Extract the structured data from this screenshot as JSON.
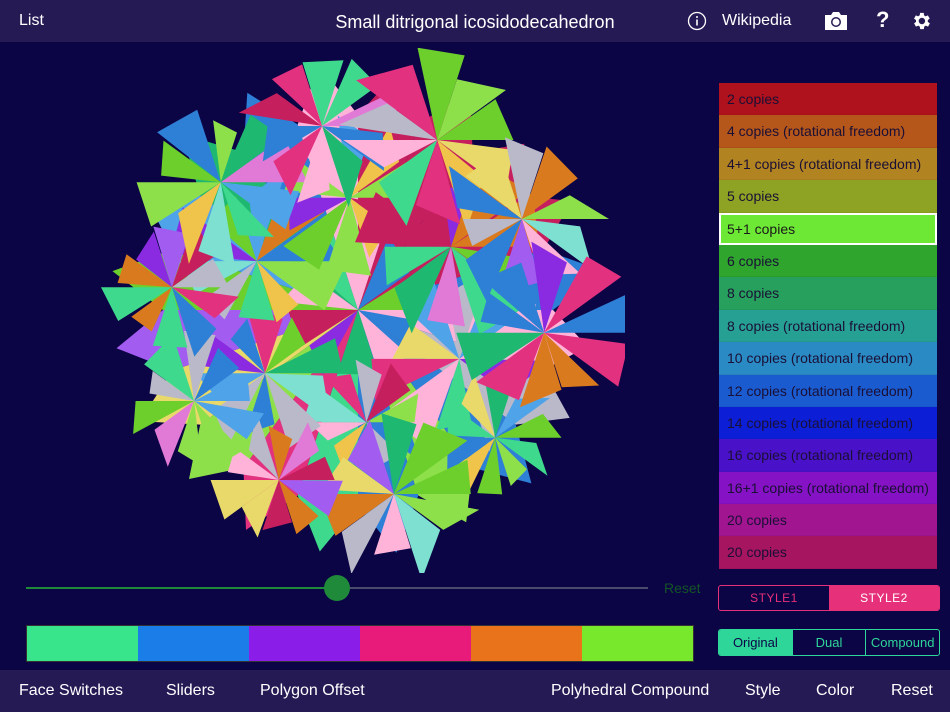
{
  "topbar": {
    "list_label": "List",
    "title": "Small ditrigonal icosidodecahedron",
    "wikipedia_label": "Wikipedia",
    "help_label": "?"
  },
  "copies": [
    {
      "label": "2 copies",
      "color": "#b0121d"
    },
    {
      "label": "4 copies (rotational freedom)",
      "color": "#b5561a"
    },
    {
      "label": "4+1 copies (rotational freedom)",
      "color": "#b28321"
    },
    {
      "label": "5 copies",
      "color": "#8ea323"
    },
    {
      "label": "5+1 copies",
      "color": "#6de835",
      "selected": true
    },
    {
      "label": "6 copies",
      "color": "#2fa52e"
    },
    {
      "label": "8 copies",
      "color": "#27a05d"
    },
    {
      "label": "8 copies (rotational freedom)",
      "color": "#27a094"
    },
    {
      "label": "10 copies (rotational freedom)",
      "color": "#2a8ac4"
    },
    {
      "label": "12 copies (rotational freedom)",
      "color": "#1b5bd0"
    },
    {
      "label": "14 copies (rotational freedom)",
      "color": "#0d1fd6"
    },
    {
      "label": "16 copies (rotational freedom)",
      "color": "#4a12c8"
    },
    {
      "label": "16+1 copies (rotational freedom)",
      "color": "#8512c4"
    },
    {
      "label": "20 copies",
      "color": "#a11591"
    },
    {
      "label": "20 copies",
      "color": "#a51560"
    }
  ],
  "slider": {
    "value": 0.5,
    "reset_label": "Reset"
  },
  "color_strip": [
    "#38e58a",
    "#1a7de8",
    "#8a1ee8",
    "#e81a7a",
    "#e8731a",
    "#78e82c"
  ],
  "style_segment": {
    "items": [
      "STYLE1",
      "STYLE2"
    ],
    "selected": 1
  },
  "mode_segment": {
    "items": [
      "Original",
      "Dual",
      "Compound"
    ],
    "selected": 0
  },
  "bottombar": {
    "face_switches": "Face Switches",
    "sliders": "Sliders",
    "polygon_offset": "Polygon Offset",
    "polyhedral_compound": "Polyhedral Compound",
    "style": "Style",
    "color": "Color",
    "reset": "Reset"
  },
  "polyhedron": {
    "face_colors": [
      "#e8d96a",
      "#f0c44a",
      "#d97a1e",
      "#b9b9c9",
      "#e2317f",
      "#c51f5e",
      "#8a2be2",
      "#a35cf0",
      "#4fa3e8",
      "#2e7fd6",
      "#3ed98c",
      "#1fb870",
      "#8ee04a",
      "#6ccf2c",
      "#e07ad6",
      "#ffb3d9",
      "#7de0d0"
    ]
  }
}
